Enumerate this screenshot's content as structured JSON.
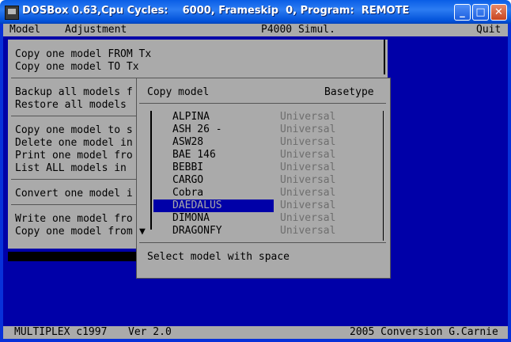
{
  "window": {
    "title": "DOSBox 0.63,Cpu Cycles:    6000, Frameskip  0, Program:  REMOTE",
    "minimize": "_",
    "maximize": "□",
    "close": "✕"
  },
  "menubar": {
    "model": "Model",
    "adjustment": "Adjustment",
    "center": "P4000 Simul.",
    "quit": "Quit"
  },
  "model_menu": {
    "items": [
      "Copy one model FROM Tx",
      "Copy one model TO Tx",
      "Backup all models f",
      "Restore all models",
      "Copy one model to s",
      "Delete one model in",
      "Print one model fro",
      "List ALL models in",
      "Convert one model i",
      "Write one model fro",
      "Copy one model from"
    ]
  },
  "dialog": {
    "title": "Copy model",
    "column_header": "Basetype",
    "rows": [
      {
        "name": "ALPINA",
        "type": "Universal"
      },
      {
        "name": "ASH 26 -",
        "type": "Universal"
      },
      {
        "name": "ASW28",
        "type": "Universal"
      },
      {
        "name": "BAE 146",
        "type": "Universal"
      },
      {
        "name": "BEBBI",
        "type": "Universal"
      },
      {
        "name": "CARGO",
        "type": "Universal"
      },
      {
        "name": "Cobra",
        "type": "Universal"
      },
      {
        "name": "DAEDALUS",
        "type": "Universal"
      },
      {
        "name": "DIMONA",
        "type": "Universal"
      },
      {
        "name": "DRAGONFY",
        "type": "Universal"
      }
    ],
    "selected_row": "DAEDALUS",
    "scroll_arrow": "▼",
    "hint": "Select model with space"
  },
  "statusbar": {
    "left": "MULTIPLEX c1997",
    "version": "Ver 2.0",
    "right": "2005 Conversion G.Carnie"
  }
}
